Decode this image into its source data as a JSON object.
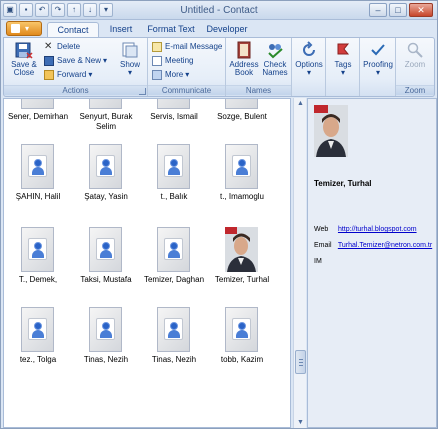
{
  "window": {
    "title": "Untitled - Contact"
  },
  "tabs": [
    {
      "label": "Contact"
    },
    {
      "label": "Insert"
    },
    {
      "label": "Format Text"
    },
    {
      "label": "Developer"
    }
  ],
  "ribbon": {
    "actions": {
      "group_label": "Actions",
      "save_close": "Save &",
      "save_close_2": "Close",
      "delete": "Delete",
      "save_new": "Save & New",
      "forward": "Forward",
      "show": "Show"
    },
    "communicate": {
      "group_label": "Communicate",
      "email": "E-mail Message",
      "meeting": "Meeting",
      "more": "More"
    },
    "names": {
      "group_label": "Names",
      "address_book_1": "Address",
      "address_book_2": "Book",
      "check_names_1": "Check",
      "check_names_2": "Names"
    },
    "options": {
      "label": "Options"
    },
    "tags": {
      "label": "Tags"
    },
    "proofing": {
      "label": "Proofing"
    },
    "zoom": {
      "label": "Zoom",
      "group_label": "Zoom"
    }
  },
  "contacts": [
    {
      "name": "Sener, Demirhan"
    },
    {
      "name": "Senyurt, Burak Selim"
    },
    {
      "name": "Servis, Ismail"
    },
    {
      "name": "Sozge, Bulent"
    },
    {
      "name": "ŞAHIN, Halil"
    },
    {
      "name": "Şatay, Yasin"
    },
    {
      "name": "t., Balık"
    },
    {
      "name": "t., Imamoglu"
    },
    {
      "name": "T., Demek,"
    },
    {
      "name": "Taksi, Mustafa"
    },
    {
      "name": "Temizer, Daghan"
    },
    {
      "name": "Temizer, Turhal"
    },
    {
      "name": "tez., Tolga"
    },
    {
      "name": "Tinas, Nezih"
    },
    {
      "name": "Tinas, Nezih"
    },
    {
      "name": "tobb, Kazim"
    }
  ],
  "detail": {
    "name": "Temizer, Turhal",
    "web_label": "Web",
    "web": "http://turhal.blogspot.com",
    "email_label": "Email",
    "email": "Turhal.Temizer@netron.com.tr",
    "im_label": "IM"
  },
  "colors": {
    "accent": "#15428b",
    "link": "#0000cc",
    "office_button": "#e08a1d"
  }
}
